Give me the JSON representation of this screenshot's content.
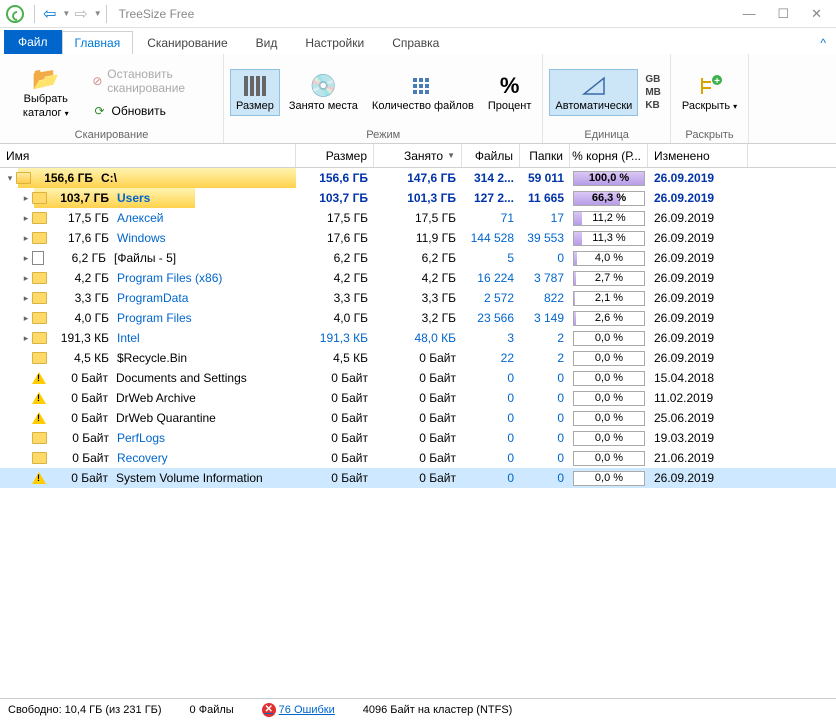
{
  "title": "TreeSize Free",
  "tabs": {
    "file": "Файл",
    "main": "Главная",
    "scan": "Сканирование",
    "view": "Вид",
    "settings": "Настройки",
    "help_tab": "Справка"
  },
  "ribbon": {
    "select_catalog": "Выбрать каталог",
    "stop_scan": "Остановить сканирование",
    "refresh": "Обновить",
    "scan_group": "Сканирование",
    "size": "Размер",
    "used": "Занято места",
    "count": "Количество файлов",
    "percent": "Процент",
    "mode_group": "Режим",
    "auto": "Автоматически",
    "gb": "GB",
    "mb": "MB",
    "kb": "KB",
    "unit_group": "Единица",
    "expand": "Раскрыть",
    "expand_group": "Раскрыть"
  },
  "cols": {
    "name": "Имя",
    "size": "Размер",
    "used": "Занято",
    "files": "Файлы",
    "dirs": "Папки",
    "pct": "% корня (Р...",
    "date": "Изменено"
  },
  "rows": [
    {
      "depth": 0,
      "exp": "open",
      "icon": "folder-open",
      "bar": 100,
      "prefix": "156,6 ГБ",
      "name": "C:\\",
      "bold": true,
      "size": "156,6 ГБ",
      "used": "147,6 ГБ",
      "files": "314 2...",
      "dirs": "59 011",
      "pct": "100,0 %",
      "pctv": 100,
      "date": "26.09.2019",
      "strong": true
    },
    {
      "depth": 1,
      "exp": "closed",
      "icon": "folder",
      "bar": 66,
      "prefix": "103,7 ГБ",
      "name": "Users",
      "bold": true,
      "link": true,
      "size": "103,7 ГБ",
      "used": "101,3 ГБ",
      "files": "127 2...",
      "dirs": "11 665",
      "pct": "66,3 %",
      "pctv": 66,
      "date": "26.09.2019",
      "strong": true
    },
    {
      "depth": 1,
      "exp": "closed",
      "icon": "folder",
      "bar": 11,
      "prefix": "17,5 ГБ",
      "name": "Алексей",
      "link": true,
      "size": "17,5 ГБ",
      "used": "17,5 ГБ",
      "files": "71",
      "dirs": "17",
      "pct": "11,2 %",
      "pctv": 11,
      "date": "26.09.2019"
    },
    {
      "depth": 1,
      "exp": "closed",
      "icon": "folder",
      "bar": 11,
      "prefix": "17,6 ГБ",
      "name": "Windows",
      "link": true,
      "size": "17,6 ГБ",
      "used": "11,9 ГБ",
      "files": "144 528",
      "dirs": "39 553",
      "pct": "11,3 %",
      "pctv": 11,
      "date": "26.09.2019"
    },
    {
      "depth": 1,
      "exp": "closed",
      "icon": "file",
      "bar": 4,
      "prefix": "6,2 ГБ",
      "name": "[Файлы - 5]",
      "size": "6,2 ГБ",
      "used": "6,2 ГБ",
      "files": "5",
      "dirs": "0",
      "pct": "4,0 %",
      "pctv": 4,
      "date": "26.09.2019"
    },
    {
      "depth": 1,
      "exp": "closed",
      "icon": "folder",
      "bar": 3,
      "prefix": "4,2 ГБ",
      "name": "Program Files (x86)",
      "link": true,
      "size": "4,2 ГБ",
      "used": "4,2 ГБ",
      "files": "16 224",
      "dirs": "3 787",
      "pct": "2,7 %",
      "pctv": 3,
      "date": "26.09.2019"
    },
    {
      "depth": 1,
      "exp": "closed",
      "icon": "folder",
      "bar": 2,
      "prefix": "3,3 ГБ",
      "name": "ProgramData",
      "link": true,
      "size": "3,3 ГБ",
      "used": "3,3 ГБ",
      "files": "2 572",
      "dirs": "822",
      "pct": "2,1 %",
      "pctv": 2,
      "date": "26.09.2019"
    },
    {
      "depth": 1,
      "exp": "closed",
      "icon": "folder",
      "bar": 3,
      "prefix": "4,0 ГБ",
      "name": "Program Files",
      "link": true,
      "size": "4,0 ГБ",
      "used": "3,2 ГБ",
      "files": "23 566",
      "dirs": "3 149",
      "pct": "2,6 %",
      "pctv": 3,
      "date": "26.09.2019"
    },
    {
      "depth": 1,
      "exp": "closed",
      "icon": "folder",
      "bar": 0,
      "prefix": "191,3 КБ",
      "name": "Intel",
      "link": true,
      "size": "191,3 КБ",
      "used": "48,0 КБ",
      "files": "3",
      "dirs": "2",
      "pct": "0,0 %",
      "pctv": 0,
      "date": "26.09.2019",
      "linkvals": true
    },
    {
      "depth": 1,
      "exp": "none",
      "icon": "folder",
      "bar": 0,
      "prefix": "4,5 КБ",
      "name": "$Recycle.Bin",
      "size": "4,5 КБ",
      "used": "0 Байт",
      "files": "22",
      "dirs": "2",
      "pct": "0,0 %",
      "pctv": 0,
      "date": "26.09.2019"
    },
    {
      "depth": 1,
      "exp": "none",
      "icon": "warn",
      "bar": 0,
      "prefix": "0 Байт",
      "name": "Documents and Settings",
      "size": "0 Байт",
      "used": "0 Байт",
      "files": "0",
      "dirs": "0",
      "pct": "0,0 %",
      "pctv": 0,
      "date": "15.04.2018"
    },
    {
      "depth": 1,
      "exp": "none",
      "icon": "warn",
      "bar": 0,
      "prefix": "0 Байт",
      "name": "DrWeb Archive",
      "size": "0 Байт",
      "used": "0 Байт",
      "files": "0",
      "dirs": "0",
      "pct": "0,0 %",
      "pctv": 0,
      "date": "11.02.2019"
    },
    {
      "depth": 1,
      "exp": "none",
      "icon": "warn",
      "bar": 0,
      "prefix": "0 Байт",
      "name": "DrWeb Quarantine",
      "size": "0 Байт",
      "used": "0 Байт",
      "files": "0",
      "dirs": "0",
      "pct": "0,0 %",
      "pctv": 0,
      "date": "25.06.2019"
    },
    {
      "depth": 1,
      "exp": "none",
      "icon": "folder",
      "bar": 0,
      "prefix": "0 Байт",
      "name": "PerfLogs",
      "link": true,
      "size": "0 Байт",
      "used": "0 Байт",
      "files": "0",
      "dirs": "0",
      "pct": "0,0 %",
      "pctv": 0,
      "date": "19.03.2019"
    },
    {
      "depth": 1,
      "exp": "none",
      "icon": "folder",
      "bar": 0,
      "prefix": "0 Байт",
      "name": "Recovery",
      "link": true,
      "size": "0 Байт",
      "used": "0 Байт",
      "files": "0",
      "dirs": "0",
      "pct": "0,0 %",
      "pctv": 0,
      "date": "21.06.2019"
    },
    {
      "depth": 1,
      "exp": "none",
      "icon": "warn",
      "bar": 0,
      "prefix": "0 Байт",
      "name": "System Volume Information",
      "size": "0 Байт",
      "used": "0 Байт",
      "files": "0",
      "dirs": "0",
      "pct": "0,0 %",
      "pctv": 0,
      "date": "26.09.2019",
      "selected": true
    }
  ],
  "status": {
    "free": "Свободно: 10,4 ГБ  (из 231 ГБ)",
    "files": "0  Файлы",
    "errors": "76 Ошибки",
    "cluster": "4096   Байт на кластер (NTFS)"
  }
}
